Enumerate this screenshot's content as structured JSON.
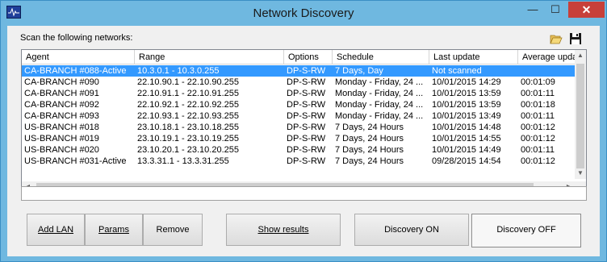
{
  "window": {
    "title": "Network Discovery",
    "minimize_label": "—",
    "maximize_label": "☐",
    "close_label": "✕"
  },
  "toolbar": {
    "scan_label": "Scan the following networks:",
    "open_icon": "folder-open-icon",
    "save_icon": "floppy-save-icon"
  },
  "table": {
    "columns": [
      "Agent",
      "Range",
      "Options",
      "Schedule",
      "Last update",
      "Average upda"
    ],
    "rows": [
      [
        "CA-BRANCH #088-Active",
        "10.3.0.1 - 10.3.0.255",
        "DP-S-RW",
        "7 Days, Day",
        "Not scanned",
        ""
      ],
      [
        "CA-BRANCH #090",
        "22.10.90.1 - 22.10.90.255",
        "DP-S-RW",
        "Monday - Friday, 24 ...",
        "10/01/2015 14:29",
        "00:01:09"
      ],
      [
        "CA-BRANCH #091",
        "22.10.91.1 - 22.10.91.255",
        "DP-S-RW",
        "Monday - Friday, 24 ...",
        "10/01/2015 13:59",
        "00:01:11"
      ],
      [
        "CA-BRANCH #092",
        "22.10.92.1 - 22.10.92.255",
        "DP-S-RW",
        "Monday - Friday, 24 ...",
        "10/01/2015 13:59",
        "00:01:18"
      ],
      [
        "CA-BRANCH #093",
        "22.10.93.1 - 22.10.93.255",
        "DP-S-RW",
        "Monday - Friday, 24 ...",
        "10/01/2015 13:49",
        "00:01:11"
      ],
      [
        "US-BRANCH #018",
        "23.10.18.1 - 23.10.18.255",
        "DP-S-RW",
        "7 Days, 24 Hours",
        "10/01/2015 14:48",
        "00:01:12"
      ],
      [
        "US-BRANCH #019",
        "23.10.19.1 - 23.10.19.255",
        "DP-S-RW",
        "7 Days, 24 Hours",
        "10/01/2015 14:55",
        "00:01:12"
      ],
      [
        "US-BRANCH #020",
        "23.10.20.1 - 23.10.20.255",
        "DP-S-RW",
        "7 Days, 24 Hours",
        "10/01/2015 14:49",
        "00:01:11"
      ],
      [
        "US-BRANCH #031-Active",
        "13.3.31.1 - 13.3.31.255",
        "DP-S-RW",
        "7 Days, 24 Hours",
        "09/28/2015 14:54",
        "00:01:12"
      ]
    ],
    "selected_row": 0
  },
  "status_field": {
    "value": ""
  },
  "buttons": {
    "add_lan": "Add LAN",
    "params": "Params",
    "remove": "Remove",
    "show_results": "Show results",
    "discovery_on": "Discovery ON",
    "discovery_off": "Discovery OFF"
  },
  "colors": {
    "title_bar": "#6fb8e0",
    "selection": "#3399ff",
    "close_button": "#c7403a"
  }
}
